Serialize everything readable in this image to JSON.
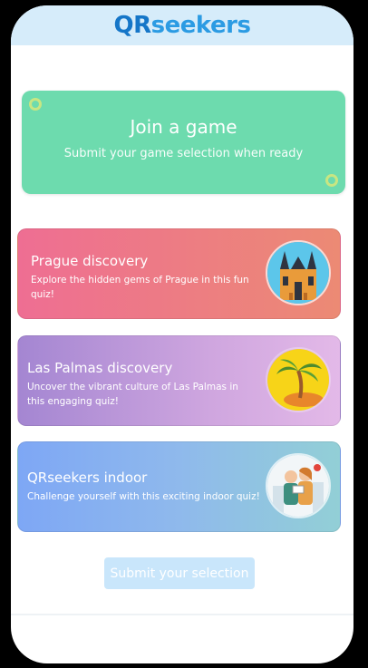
{
  "header": {
    "logo_qr": "QR",
    "logo_rest": "seekers"
  },
  "join": {
    "title": "Join a game",
    "subtitle": "Submit your game selection when ready"
  },
  "games": [
    {
      "title": "Prague discovery",
      "description": "Explore the hidden gems of Prague in this fun quiz!",
      "image": "prague-church-icon"
    },
    {
      "title": "Las Palmas discovery",
      "description": "Uncover the vibrant culture of Las Palmas in this engaging quiz!",
      "image": "palm-tree-icon"
    },
    {
      "title": "QRseekers indoor",
      "description": "Challenge yourself with this exciting indoor quiz!",
      "image": "explorers-icon"
    }
  ],
  "submit": {
    "label": "Submit your selection"
  },
  "colors": {
    "header_bg": "#d6ecfa",
    "join_bg": "#6ddbae",
    "logo_blue": "#1576c8",
    "submit_bg": "#c9e6fb"
  }
}
